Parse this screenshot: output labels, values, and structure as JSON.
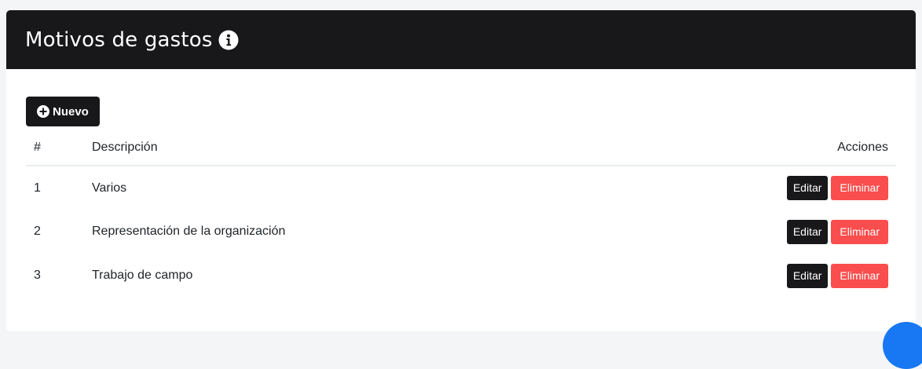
{
  "header": {
    "title": "Motivos de gastos",
    "info_icon": "info-circle-icon"
  },
  "toolbar": {
    "new_label": "Nuevo",
    "new_icon": "plus-circle-icon"
  },
  "table": {
    "columns": [
      "#",
      "Descripción",
      "Acciones"
    ],
    "rows": [
      {
        "num": "1",
        "description": "Varios",
        "edit": "Editar",
        "delete": "Eliminar"
      },
      {
        "num": "2",
        "description": "Representación de la organización",
        "edit": "Editar",
        "delete": "Eliminar"
      },
      {
        "num": "3",
        "description": "Trabajo de campo",
        "edit": "Editar",
        "delete": "Eliminar"
      }
    ]
  },
  "colors": {
    "header_bg": "#18181b",
    "danger": "#fa4d4d",
    "fab": "#1877f2"
  }
}
